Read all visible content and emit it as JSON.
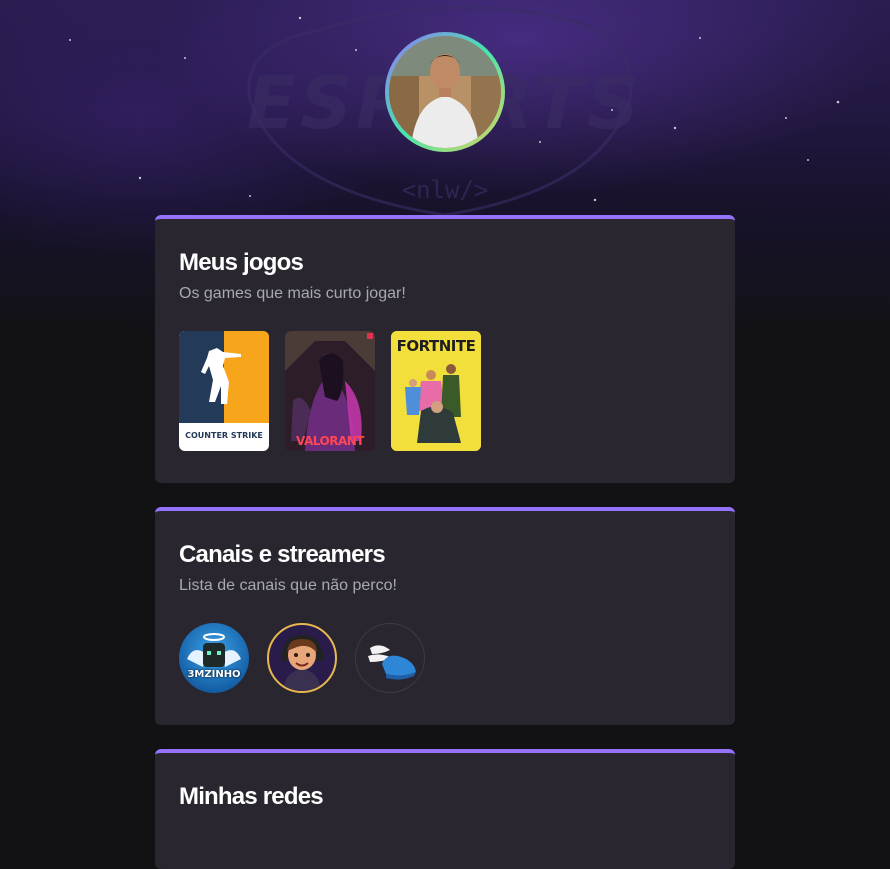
{
  "hero": {
    "background_mark": "ESPORTS",
    "background_tag": "<nlw/>"
  },
  "profile": {
    "avatar_icon": "profile-photo"
  },
  "sections": {
    "games": {
      "title": "Meus jogos",
      "subtitle": "Os games que mais curto jogar!",
      "items": [
        {
          "label": "COUNTER STRIKE",
          "icon": "counter-strike-cover"
        },
        {
          "label": "VALORANT",
          "icon": "valorant-cover"
        },
        {
          "label": "FORTNITE",
          "icon": "fortnite-cover"
        }
      ]
    },
    "streamers": {
      "title": "Canais e streamers",
      "subtitle": "Lista de canais que não perco!",
      "items": [
        {
          "label": "3MZINHO",
          "icon": "3mzinho-avatar"
        },
        {
          "label": "",
          "icon": "streamer-avatar-cartoon"
        },
        {
          "label": "",
          "icon": "winged-shoe-avatar"
        }
      ]
    },
    "social": {
      "title": "Minhas redes"
    }
  },
  "colors": {
    "accent": "#9572fc",
    "card_bg": "#29262f",
    "page_bg": "#121214",
    "subtitle": "#a8a8b3"
  }
}
